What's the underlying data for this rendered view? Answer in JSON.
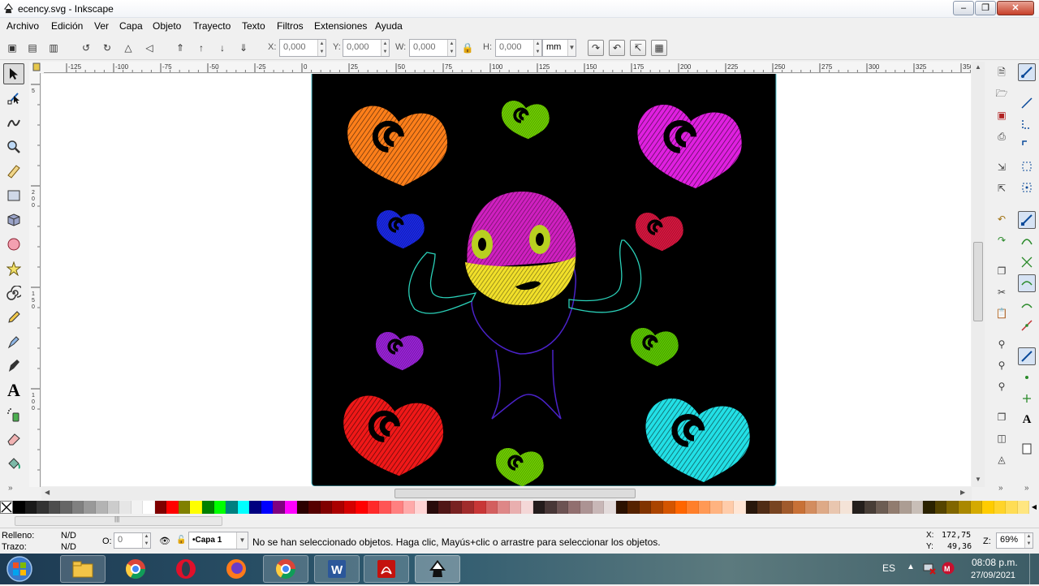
{
  "window": {
    "title": "ecency.svg - Inkscape"
  },
  "menu": [
    "Archivo",
    "Edición",
    "Ver",
    "Capa",
    "Objeto",
    "Trayecto",
    "Texto",
    "Filtros",
    "Extensiones",
    "Ayuda"
  ],
  "controls": {
    "x_label": "X:",
    "x_value": "0,000",
    "y_label": "Y:",
    "y_value": "0,000",
    "w_label": "W:",
    "w_value": "0,000",
    "h_label": "H:",
    "h_value": "0,000",
    "unit": "mm"
  },
  "ruler": {
    "top_ticks": [
      "-125",
      "-100",
      "-75",
      "-50",
      "-25",
      "0",
      "25",
      "50",
      "75",
      "100",
      "125",
      "150",
      "175",
      "200",
      "225",
      "250",
      "275",
      "300",
      "325",
      "350"
    ],
    "left_ticks": [
      "5",
      "2\n0\n0",
      "1\n5\n0",
      "1\n0\n0",
      "5"
    ]
  },
  "tools": [
    "selector",
    "node-editor",
    "tweak",
    "zoom",
    "measure",
    "rectangle",
    "3d-box",
    "ellipse",
    "star",
    "spiral",
    "pencil",
    "pen",
    "calligraphy",
    "text",
    "spray",
    "eraser",
    "paint-bucket"
  ],
  "palette_colors": [
    "#000000",
    "#1a1a1a",
    "#333333",
    "#4d4d4d",
    "#666666",
    "#808080",
    "#999999",
    "#b3b3b3",
    "#cccccc",
    "#e6e6e6",
    "#f2f2f2",
    "#ffffff",
    "#800000",
    "#ff0000",
    "#808000",
    "#ffff00",
    "#008000",
    "#00ff00",
    "#008080",
    "#00ffff",
    "#000080",
    "#0000ff",
    "#800080",
    "#ff00ff",
    "#2b0000",
    "#550000",
    "#800000",
    "#aa0000",
    "#d40000",
    "#ff0000",
    "#ff2a2a",
    "#ff5555",
    "#ff8080",
    "#ffaaaa",
    "#ffd5d5",
    "#280b0b",
    "#501616",
    "#782121",
    "#a02c2c",
    "#c83737",
    "#d35f5f",
    "#de8787",
    "#e9afaf",
    "#f4d7d7",
    "#241c1c",
    "#483737",
    "#6c5353",
    "#916f6f",
    "#ac9393",
    "#c8b7b7",
    "#e3dbdb",
    "#2b1100",
    "#552200",
    "#803300",
    "#aa4400",
    "#d45500",
    "#ff6600",
    "#ff7f2a",
    "#ff9955",
    "#ffb380",
    "#ffccaa",
    "#ffe6d5",
    "#28170b",
    "#502d16",
    "#784421",
    "#a05a2c",
    "#c87137",
    "#d38d5f",
    "#deaa87",
    "#e9c6af",
    "#f4e3d7",
    "#241f1c",
    "#483e37",
    "#6c5d53",
    "#917c6f",
    "#ac9d93",
    "#c8beb7",
    "#2b2200",
    "#554400",
    "#806600",
    "#aa8800",
    "#d4aa00",
    "#ffcc00",
    "#ffd42a",
    "#ffdd55",
    "#ffe680"
  ],
  "status": {
    "fill_label": "Relleno:",
    "fill_value": "N/D",
    "stroke_label": "Trazo:",
    "stroke_value": "N/D",
    "opacity_label": "O:",
    "opacity_value": "0",
    "layer": "•Capa 1",
    "message": "No se han seleccionado objetos. Haga clic, Mayús+clic o arrastre para seleccionar los objetos.",
    "cursor_x_label": "X:",
    "cursor_x": "172,75",
    "cursor_y_label": "Y:",
    "cursor_y": "49,36",
    "zoom_label": "Z:",
    "zoom": "69%"
  },
  "taskbar": {
    "apps": [
      "explorer",
      "chrome",
      "opera",
      "firefox",
      "chrome",
      "word",
      "acrobat",
      "inkscape"
    ],
    "lang": "ES",
    "time": "08:08 p.m.",
    "date": "27/09/2021"
  }
}
